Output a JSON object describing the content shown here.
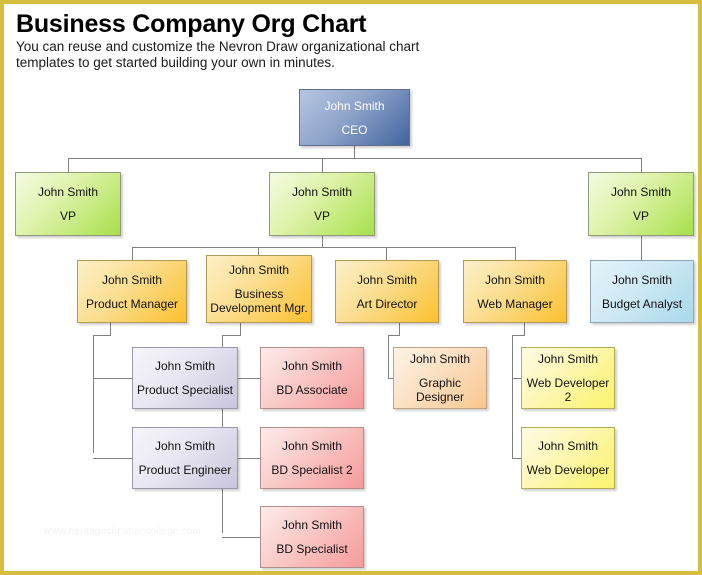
{
  "header": {
    "title": "Business Company Org Chart",
    "subtitle": "You can reuse and customize the Nevron Draw organizational chart templates to get started building your own in minutes."
  },
  "watermark": "www.heritagechristiancollege.com",
  "colors": {
    "frame_border": "#d7bd3e",
    "connector": "#808080",
    "ceo": "#41639f",
    "vp": "#a7e04b",
    "manager": "#fbc02d",
    "analyst": "#a8d8ea",
    "specialist": "#c9c5dc",
    "bd": "#f59b9b",
    "designer": "#f9c78f",
    "developer": "#fbf36a"
  },
  "nodes": [
    {
      "id": "ceo",
      "name": "John Smith",
      "role": "CEO"
    },
    {
      "id": "vp-left",
      "name": "John Smith",
      "role": "VP"
    },
    {
      "id": "vp-center",
      "name": "John Smith",
      "role": "VP"
    },
    {
      "id": "vp-right",
      "name": "John Smith",
      "role": "VP"
    },
    {
      "id": "product-manager",
      "name": "John Smith",
      "role": "Product Manager"
    },
    {
      "id": "bd-manager",
      "name": "John Smith",
      "role": "Business\nDevelopment Mgr."
    },
    {
      "id": "art-director",
      "name": "John Smith",
      "role": "Art Director"
    },
    {
      "id": "web-manager",
      "name": "John Smith",
      "role": "Web Manager"
    },
    {
      "id": "budget-analyst",
      "name": "John Smith",
      "role": "Budget Analyst"
    },
    {
      "id": "product-specialist",
      "name": "John Smith",
      "role": "Product Specialist"
    },
    {
      "id": "bd-associate",
      "name": "John Smith",
      "role": "BD Associate"
    },
    {
      "id": "graphic-designer",
      "name": "John Smith",
      "role": "Graphic Designer"
    },
    {
      "id": "web-developer-2",
      "name": "John Smith",
      "role": "Web Developer 2"
    },
    {
      "id": "product-engineer",
      "name": "John Smith",
      "role": "Product Engineer"
    },
    {
      "id": "bd-specialist-2",
      "name": "John Smith",
      "role": "BD Specialist 2"
    },
    {
      "id": "web-developer",
      "name": "John Smith",
      "role": "Web Developer"
    },
    {
      "id": "bd-specialist",
      "name": "John Smith",
      "role": "BD Specialist"
    }
  ]
}
